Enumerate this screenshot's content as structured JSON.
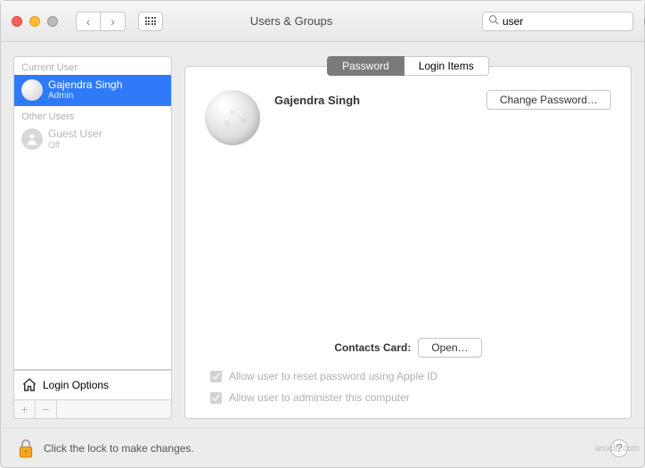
{
  "window": {
    "title": "Users & Groups"
  },
  "search": {
    "value": "user"
  },
  "sidebar": {
    "section_current": "Current User",
    "section_other": "Other Users",
    "current_user": {
      "name": "Gajendra Singh",
      "role": "Admin"
    },
    "guest_user": {
      "name": "Guest User",
      "status": "Off"
    },
    "login_options": "Login Options"
  },
  "tabs": {
    "password": "Password",
    "login_items": "Login Items"
  },
  "main": {
    "user_name": "Gajendra Singh",
    "change_password": "Change Password…",
    "contacts_label": "Contacts Card:",
    "open_button": "Open…",
    "check_apple_id": "Allow user to reset password using Apple ID",
    "check_admin": "Allow user to administer this computer"
  },
  "footer": {
    "lock_text": "Click the lock to make changes."
  },
  "watermark": "wsxdn.com"
}
